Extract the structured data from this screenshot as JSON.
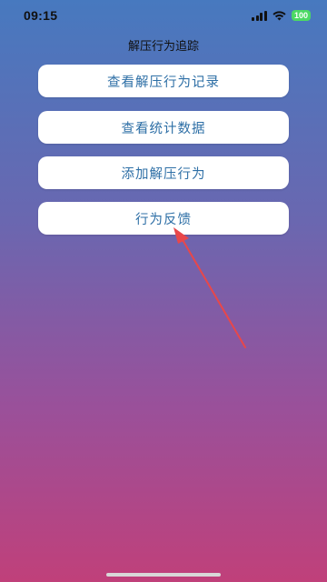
{
  "status_bar": {
    "time": "09:15",
    "battery": "100",
    "icons": [
      "cellular-signal-icon",
      "wifi-icon",
      "battery-icon"
    ]
  },
  "page": {
    "title": "解压行为追踪"
  },
  "menu": {
    "view_records_label": "查看解压行为记录",
    "view_stats_label": "查看统计数据",
    "add_behavior_label": "添加解压行为",
    "feedback_label": "行为反馈"
  },
  "annotation": {
    "arrow_color": "#e8474a"
  },
  "colors": {
    "button_text": "#2e6fa6",
    "gradient_top": "#4779bf",
    "gradient_bottom": "#c0407a"
  }
}
